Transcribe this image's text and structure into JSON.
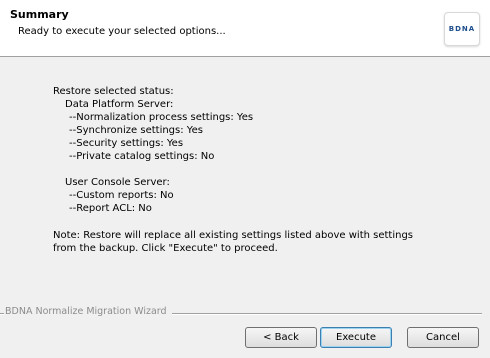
{
  "header": {
    "title": "Summary",
    "subtitle": "Ready to execute your selected options...",
    "logo_text": "BDNA"
  },
  "content": {
    "lines": [
      "Restore selected status:",
      "Data Platform Server:",
      "--Normalization process settings: Yes",
      "--Synchronize settings: Yes",
      "--Security settings: Yes",
      "--Private catalog settings: No",
      "User Console Server:",
      "--Custom reports: No",
      "--Report ACL: No"
    ],
    "note": "Note:  Restore will replace all existing settings listed above with settings from the backup.   Click \"Execute\" to proceed."
  },
  "footer": {
    "wizard_label": "BDNA Normalize Migration Wizard"
  },
  "buttons": {
    "back": "< Back",
    "execute": "Execute",
    "cancel": "Cancel"
  }
}
